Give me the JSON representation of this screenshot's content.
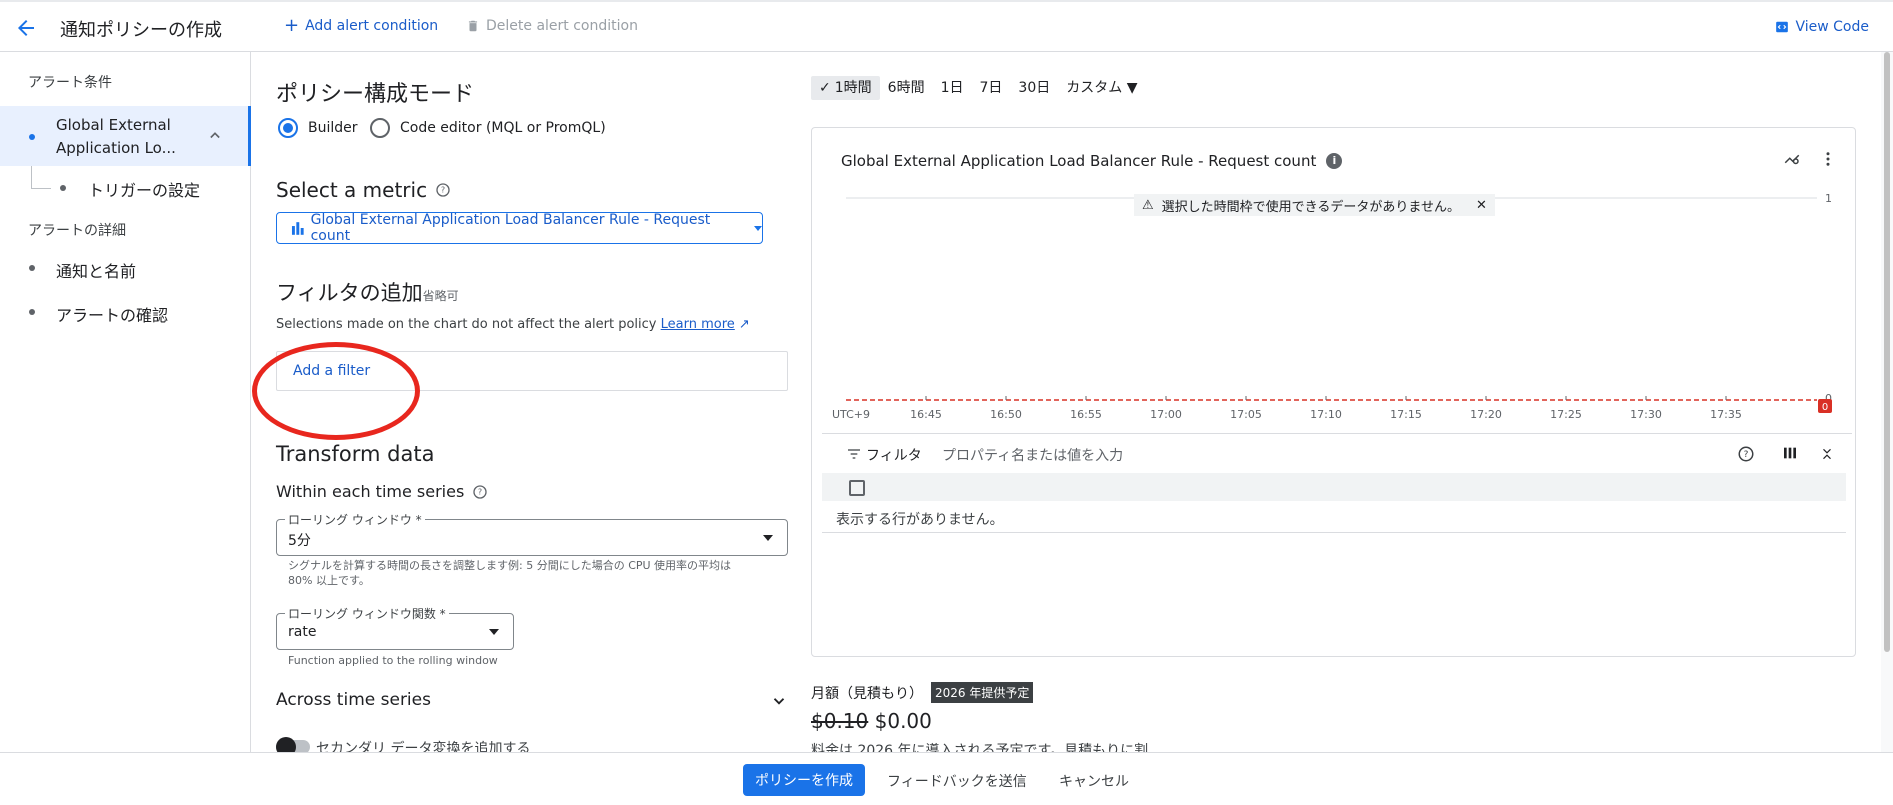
{
  "header": {
    "title": "通知ポリシーの作成",
    "add_condition": "Add alert condition",
    "delete_condition": "Delete alert condition",
    "view_code": "View Code"
  },
  "sidebar": {
    "section1": "アラート条件",
    "selected_item": "Global External Application Lo...",
    "sub_item": "トリガーの設定",
    "section2": "アラートの詳細",
    "items": [
      {
        "label": "通知と名前"
      },
      {
        "label": "アラートの確認"
      }
    ]
  },
  "main": {
    "mode_title": "ポリシー構成モード",
    "mode_options": [
      {
        "label": "Builder",
        "selected": true
      },
      {
        "label": "Code editor (MQL or PromQL)",
        "selected": false
      }
    ],
    "metric_title": "Select a metric",
    "metric_value": "Global External Application Load Balancer Rule - Request count",
    "filter_title": "フィルタの追加",
    "filter_optional": "省略可",
    "filter_hint": "Selections made on the chart do not affect the alert policy",
    "learn_more": "Learn more",
    "add_filter": "Add a filter",
    "transform_title": "Transform data",
    "within_title": "Within each time series",
    "rolling_window_label": "ローリング ウィンドウ *",
    "rolling_window_value": "5分",
    "rolling_window_help": "シグナルを計算する時間の長さを調整します例: 5 分間にした場合の CPU 使用率の平均は 80% 以上です。",
    "rolling_fn_label": "ローリング ウィンドウ関数 *",
    "rolling_fn_value": "rate",
    "rolling_fn_help": "Function applied to the rolling window",
    "across_title": "Across time series",
    "secondary_toggle": "セカンダリ データ変換を追加する"
  },
  "chart": {
    "time_ranges": [
      "1時間",
      "6時間",
      "1日",
      "7日",
      "30日",
      "カスタム"
    ],
    "selected_range": "1時間",
    "title": "Global External Application Load Balancer Rule - Request count",
    "no_data": "選択した時間枠で使用できるデータがありません。",
    "threshold_badge": "0",
    "timezone": "UTC+9",
    "filter_label": "フィルタ",
    "filter_placeholder": "プロパティ名または値を入力",
    "empty_table": "表示する行がありません。"
  },
  "chart_data": {
    "type": "line",
    "title": "Global External Application Load Balancer Rule - Request count",
    "x": [
      "16:45",
      "16:50",
      "16:55",
      "17:00",
      "17:05",
      "17:10",
      "17:15",
      "17:20",
      "17:25",
      "17:30",
      "17:35"
    ],
    "series": [],
    "ylim": [
      0,
      1
    ],
    "y_ticks": [
      "1",
      "0"
    ],
    "threshold": 0,
    "grid": true
  },
  "cost": {
    "label": "月額（見積もり）",
    "badge": "2026 年提供予定",
    "old_price": "$0.10",
    "new_price": "$0.00",
    "note": "料金は 2026 年に導入される予定です。見積もりに割"
  },
  "footer": {
    "create": "ポリシーを作成",
    "feedback": "フィードバックを送信",
    "cancel": "キャンセル"
  },
  "colors": {
    "primary": "#1a73e8",
    "annotation": "#e8271e",
    "threshold": "#d93025"
  }
}
